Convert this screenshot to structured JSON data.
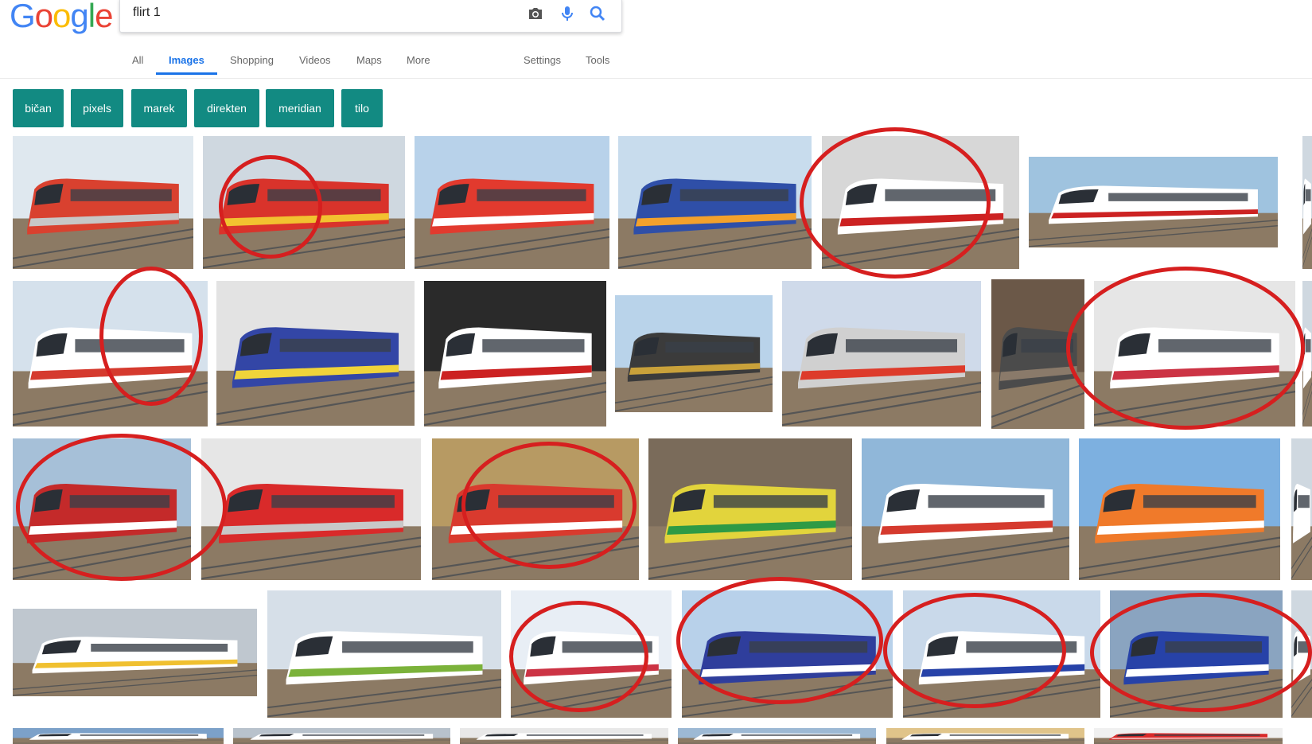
{
  "logo": {
    "g1": "G",
    "o1": "o",
    "o2": "o",
    "g2": "g",
    "l": "l",
    "e": "e"
  },
  "search": {
    "query": "flirt 1"
  },
  "icons": {
    "camera": "camera-icon",
    "mic": "microphone-icon",
    "search": "search-icon"
  },
  "tabs": {
    "all": "All",
    "images": "Images",
    "shopping": "Shopping",
    "videos": "Videos",
    "maps": "Maps",
    "more": "More",
    "settings": "Settings",
    "tools": "Tools"
  },
  "chips": [
    "bičan",
    "pixels",
    "marek",
    "direkten",
    "meridian",
    "tilo"
  ],
  "colors": {
    "accent": "#1a73e8",
    "chip": "#128a82",
    "annotation": "#d61f1f"
  }
}
